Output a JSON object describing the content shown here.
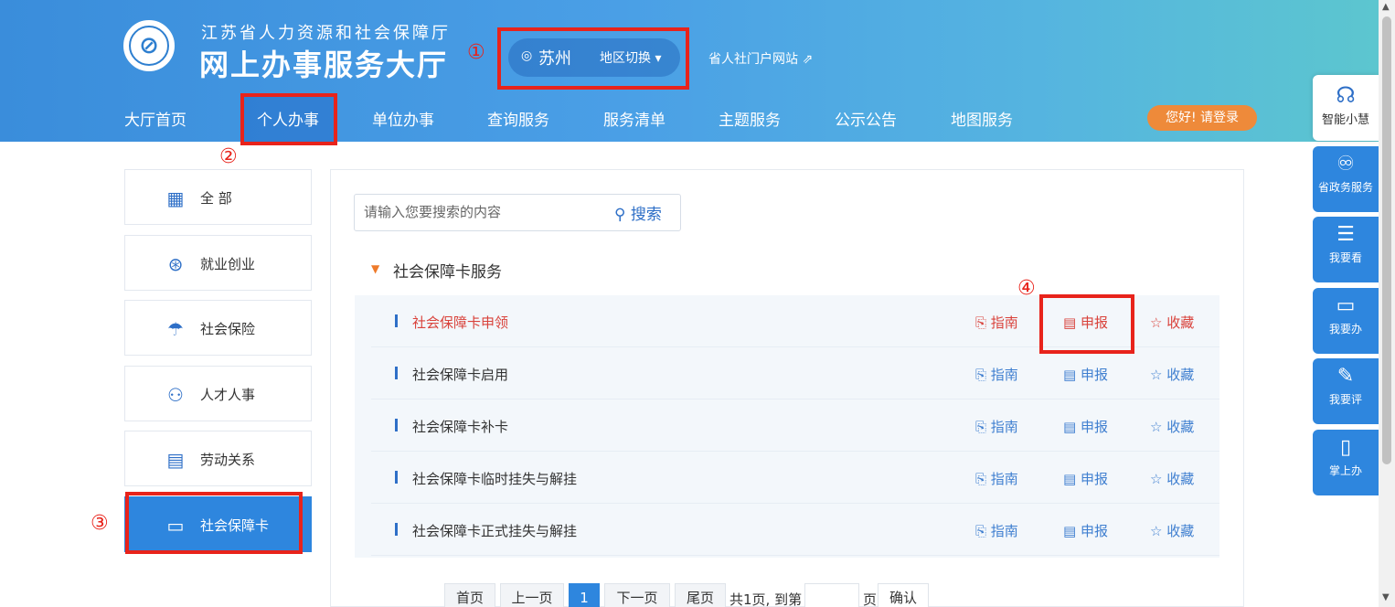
{
  "header": {
    "org_name": "江苏省人力资源和社会保障厅",
    "site_name": "网上办事服务大厅",
    "city": "苏州",
    "switch_label": "地区切换 ▾",
    "portal_link": "省人社门户网站 ⇗",
    "login": "您好! 请登录"
  },
  "annotations": [
    "①",
    "②",
    "③",
    "④"
  ],
  "nav": [
    "大厅首页",
    "个人办事",
    "单位办事",
    "查询服务",
    "服务清单",
    "主题服务",
    "公示公告",
    "地图服务"
  ],
  "sidebar": [
    {
      "label": "全 部",
      "icon": "grid-icon"
    },
    {
      "label": "就业创业",
      "icon": "tie-icon"
    },
    {
      "label": "社会保险",
      "icon": "umbrella-icon"
    },
    {
      "label": "人才人事",
      "icon": "people-icon"
    },
    {
      "label": "劳动关系",
      "icon": "document-icon"
    },
    {
      "label": "社会保障卡",
      "icon": "card-icon"
    }
  ],
  "search": {
    "placeholder": "请输入您要搜索的内容",
    "button": "搜索"
  },
  "section": {
    "title": "社会保障卡服务"
  },
  "rows": [
    {
      "name": "社会保障卡申领",
      "guide": "指南",
      "apply": "申报",
      "fav": "收藏"
    },
    {
      "name": "社会保障卡启用",
      "guide": "指南",
      "apply": "申报",
      "fav": "收藏"
    },
    {
      "name": "社会保障卡补卡",
      "guide": "指南",
      "apply": "申报",
      "fav": "收藏"
    },
    {
      "name": "社会保障卡临时挂失与解挂",
      "guide": "指南",
      "apply": "申报",
      "fav": "收藏"
    },
    {
      "name": "社会保障卡正式挂失与解挂",
      "guide": "指南",
      "apply": "申报",
      "fav": "收藏"
    }
  ],
  "pagination": {
    "first": "首页",
    "prev": "上一页",
    "current": "1",
    "next": "下一页",
    "last": "尾页",
    "total": "共1页, 到第",
    "page_unit": "页",
    "confirm": "确认"
  },
  "float": {
    "ai": "智能小慧",
    "gov": "省政务服务",
    "look": "我要看",
    "do": "我要办",
    "rate": "我要评",
    "mobile": "掌上办"
  }
}
